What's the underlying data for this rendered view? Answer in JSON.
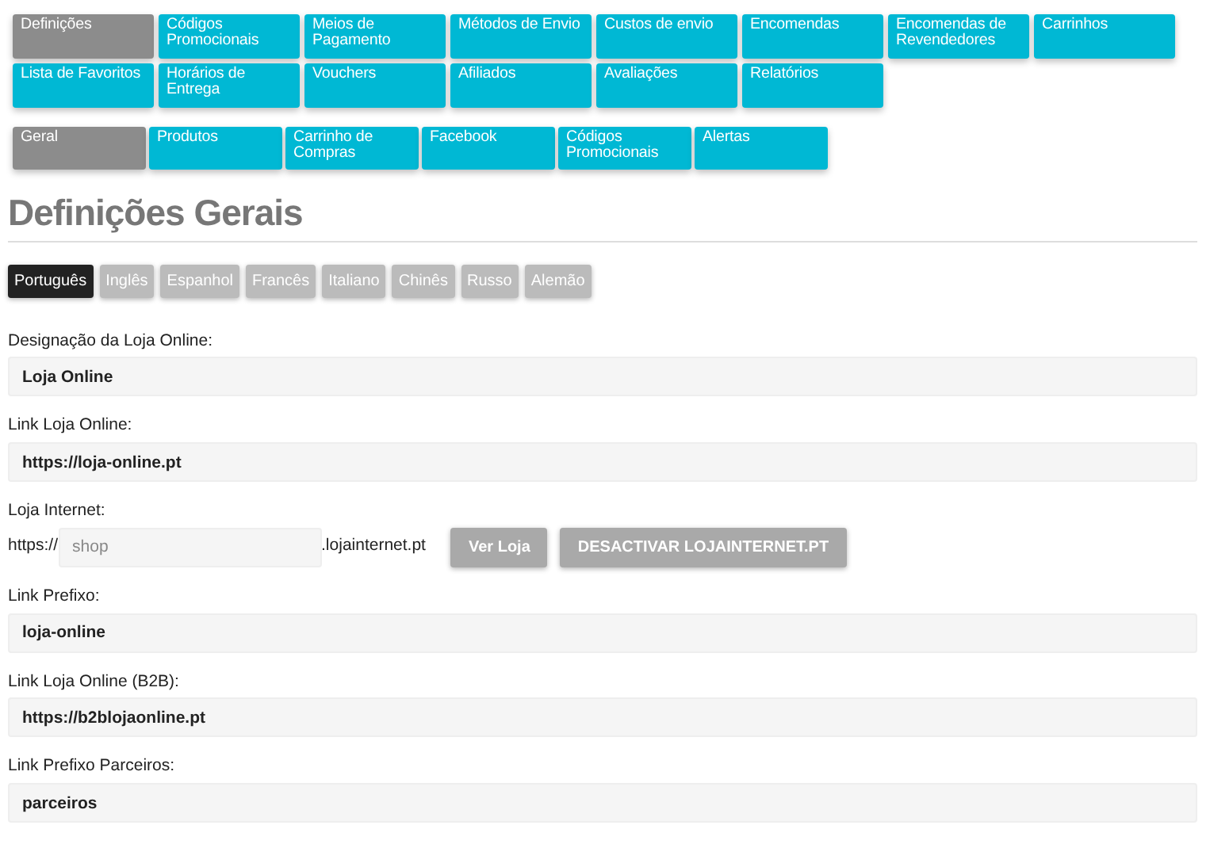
{
  "main_tabs": [
    {
      "label": "Definições",
      "selected": true
    },
    {
      "label": "Códigos Promocionais",
      "selected": false
    },
    {
      "label": "Meios de Pagamento",
      "selected": false
    },
    {
      "label": "Métodos de Envio",
      "selected": false
    },
    {
      "label": "Custos de envio",
      "selected": false
    },
    {
      "label": "Encomendas",
      "selected": false
    },
    {
      "label": "Encomendas de Revendedores",
      "selected": false
    },
    {
      "label": "Carrinhos",
      "selected": false
    },
    {
      "label": "Lista de Favoritos",
      "selected": false
    },
    {
      "label": "Horários de Entrega",
      "selected": false
    },
    {
      "label": "Vouchers",
      "selected": false
    },
    {
      "label": "Afiliados",
      "selected": false
    },
    {
      "label": "Avaliações",
      "selected": false
    },
    {
      "label": "Relatórios",
      "selected": false
    }
  ],
  "sub_tabs": [
    {
      "label": "Geral",
      "selected": true
    },
    {
      "label": "Produtos",
      "selected": false
    },
    {
      "label": "Carrinho de Compras",
      "selected": false
    },
    {
      "label": "Facebook",
      "selected": false
    },
    {
      "label": "Códigos Promocionais",
      "selected": false
    },
    {
      "label": "Alertas",
      "selected": false
    }
  ],
  "heading": "Definições Gerais",
  "languages": [
    {
      "label": "Português",
      "selected": true
    },
    {
      "label": "Inglês",
      "selected": false
    },
    {
      "label": "Espanhol",
      "selected": false
    },
    {
      "label": "Francês",
      "selected": false
    },
    {
      "label": "Italiano",
      "selected": false
    },
    {
      "label": "Chinês",
      "selected": false
    },
    {
      "label": "Russo",
      "selected": false
    },
    {
      "label": "Alemão",
      "selected": false
    }
  ],
  "fields": [
    {
      "kind": "text",
      "label": "Designação da Loja Online:",
      "value": "Loja Online"
    },
    {
      "kind": "text",
      "label": "Link Loja Online:",
      "value": "https://loja-online.pt"
    },
    {
      "kind": "subdomain",
      "label": "Loja Internet:",
      "prefix": "https://",
      "placeholder": "shop",
      "suffix": ".lojainternet.pt",
      "buttons": [
        "Ver Loja",
        "DESACTIVAR LOJAINTERNET.PT"
      ]
    },
    {
      "kind": "text",
      "label": "Link Prefixo:",
      "value": "loja-online"
    },
    {
      "kind": "text",
      "label": "Link Loja Online (B2B):",
      "value": "https://b2blojaonline.pt"
    },
    {
      "kind": "text",
      "label": "Link Prefixo Parceiros:",
      "value": "parceiros"
    }
  ]
}
